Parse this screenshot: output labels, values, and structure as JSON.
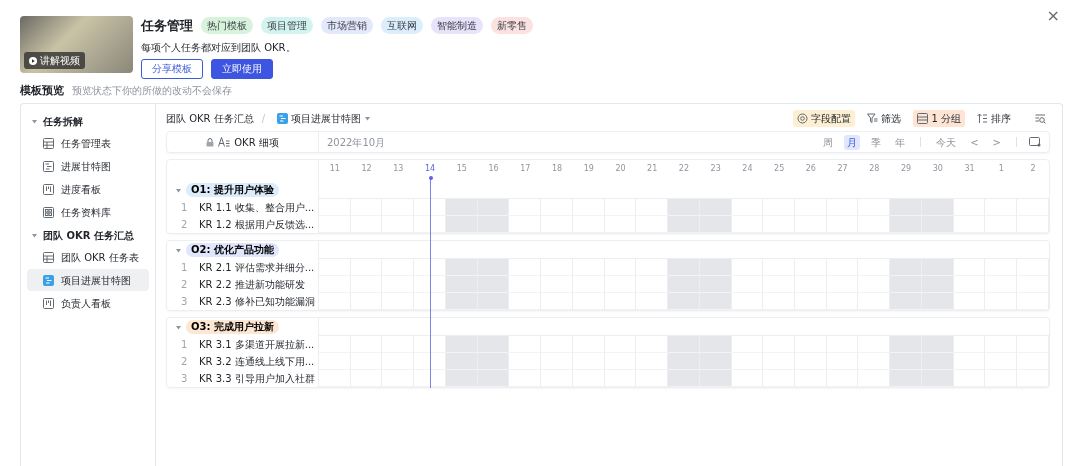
{
  "close_label": "×",
  "template": {
    "title": "任务管理",
    "description": "每项个人任务都对应到团队 OKR。",
    "video_badge": "讲解视频",
    "tags": [
      {
        "label": "热门模板",
        "color": "#d8f3dc"
      },
      {
        "label": "项目管理",
        "color": "#d3f3ee"
      },
      {
        "label": "市场营销",
        "color": "#e3e8fb"
      },
      {
        "label": "互联网",
        "color": "#dcedfb"
      },
      {
        "label": "智能制造",
        "color": "#e8e3fa"
      },
      {
        "label": "新零售",
        "color": "#fbe1e1"
      }
    ],
    "buttons": [
      {
        "label": "分享模板",
        "kind": "outline"
      },
      {
        "label": "立即使用",
        "kind": "primary"
      }
    ]
  },
  "preview": {
    "title": "模板预览",
    "note": "预览状态下你的所做的改动不会保存"
  },
  "sidebar": {
    "sections": [
      {
        "label": "任务拆解",
        "expanded": true,
        "items": [
          {
            "label": "任务管理表",
            "kind": "table",
            "selected": false
          },
          {
            "label": "进展甘特图",
            "kind": "gantt",
            "selected": false
          },
          {
            "label": "进度看板",
            "kind": "kanban",
            "selected": false
          },
          {
            "label": "任务资料库",
            "kind": "gallery",
            "selected": false
          }
        ]
      },
      {
        "label": "团队 OKR 任务汇总",
        "expanded": true,
        "items": [
          {
            "label": "团队 OKR 任务表",
            "kind": "table",
            "selected": false
          },
          {
            "label": "项目进展甘特图",
            "kind": "gantt",
            "selected": true
          },
          {
            "label": "负责人看板",
            "kind": "kanban",
            "selected": false
          }
        ]
      }
    ]
  },
  "breadcrumb": {
    "parent": "团队 OKR 任务汇总",
    "separator": "/",
    "current": "项目进展甘特图"
  },
  "toolbar": [
    {
      "label": "字段配置",
      "kind": "settings",
      "active": true
    },
    {
      "label": "筛选",
      "kind": "filter",
      "active": false
    },
    {
      "label": "1 分组",
      "kind": "group",
      "active": true
    },
    {
      "label": "排序",
      "kind": "sort",
      "active": false
    }
  ],
  "gantt": {
    "field_header": "OKR 细项",
    "month": "2022年10月",
    "scales": [
      {
        "label": "周",
        "selected": false
      },
      {
        "label": "月",
        "selected": true
      },
      {
        "label": "季",
        "selected": false
      },
      {
        "label": "年",
        "selected": false
      }
    ],
    "today_label": "今天",
    "prev_label": "<",
    "next_label": ">",
    "days": [
      {
        "label": "11",
        "weekend": false,
        "today": false
      },
      {
        "label": "12",
        "weekend": false,
        "today": false
      },
      {
        "label": "13",
        "weekend": false,
        "today": false
      },
      {
        "label": "14",
        "weekend": false,
        "today": true
      },
      {
        "label": "15",
        "weekend": true,
        "today": false
      },
      {
        "label": "16",
        "weekend": true,
        "today": false
      },
      {
        "label": "17",
        "weekend": false,
        "today": false
      },
      {
        "label": "18",
        "weekend": false,
        "today": false
      },
      {
        "label": "19",
        "weekend": false,
        "today": false
      },
      {
        "label": "20",
        "weekend": false,
        "today": false
      },
      {
        "label": "21",
        "weekend": false,
        "today": false
      },
      {
        "label": "22",
        "weekend": true,
        "today": false
      },
      {
        "label": "23",
        "weekend": true,
        "today": false
      },
      {
        "label": "24",
        "weekend": false,
        "today": false
      },
      {
        "label": "25",
        "weekend": false,
        "today": false
      },
      {
        "label": "26",
        "weekend": false,
        "today": false
      },
      {
        "label": "27",
        "weekend": false,
        "today": false
      },
      {
        "label": "28",
        "weekend": false,
        "today": false
      },
      {
        "label": "29",
        "weekend": true,
        "today": false
      },
      {
        "label": "30",
        "weekend": true,
        "today": false
      },
      {
        "label": "31",
        "weekend": false,
        "today": false
      },
      {
        "label": "1",
        "weekend": false,
        "today": false
      },
      {
        "label": "2",
        "weekend": false,
        "today": false
      }
    ],
    "groups": [
      {
        "label": "O1: 提升用户体验",
        "color": "#dcecfb",
        "expanded": true,
        "rows": [
          {
            "index": "1",
            "title": "KR 1.1 收集、整合用户..."
          },
          {
            "index": "2",
            "title": "KR 1.2 根据用户反馈选..."
          }
        ]
      },
      {
        "label": "O2: 优化产品功能",
        "color": "#e0e6fb",
        "expanded": true,
        "rows": [
          {
            "index": "1",
            "title": "KR 2.1 评估需求并细分..."
          },
          {
            "index": "2",
            "title": "KR 2.2 推进新功能研发"
          },
          {
            "index": "3",
            "title": "KR 2.3 修补已知功能漏洞"
          }
        ]
      },
      {
        "label": "O3: 完成用户拉新",
        "color": "#fde6d2",
        "expanded": true,
        "rows": [
          {
            "index": "1",
            "title": "KR 3.1 多渠道开展拉新..."
          },
          {
            "index": "2",
            "title": "KR 3.2 连通线上线下用..."
          },
          {
            "index": "3",
            "title": "KR 3.3 引导用户加入社群"
          }
        ]
      }
    ]
  }
}
